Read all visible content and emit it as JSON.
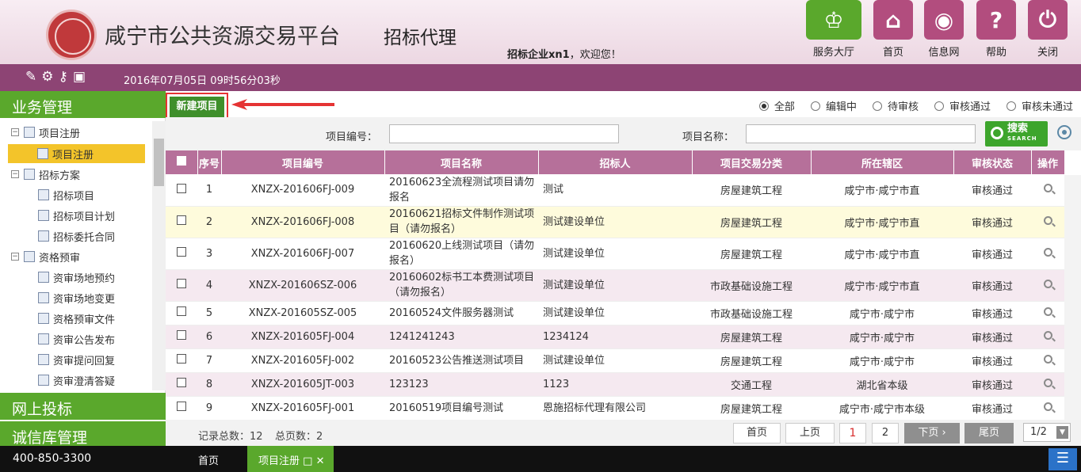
{
  "header": {
    "site_title": "咸宁市公共资源交易平台",
    "sub_title": "招标代理",
    "welcome_user": "招标企业xn1",
    "welcome_suffix": "，欢迎您！",
    "nav": [
      {
        "label": "服务大厅",
        "icon": "service-hall-icon",
        "color": "#5aa82c"
      },
      {
        "label": "首页",
        "icon": "home-icon",
        "color": "#b24d7e"
      },
      {
        "label": "信息网",
        "icon": "globe-icon",
        "color": "#b24d7e"
      },
      {
        "label": "帮助",
        "icon": "help-icon",
        "color": "#b24d7e"
      },
      {
        "label": "关闭",
        "icon": "power-icon",
        "color": "#b24d7e"
      }
    ]
  },
  "toolbar": {
    "datetime": "2016年07月05日 09时56分03秒",
    "icons": [
      "chat-icon",
      "gear-icon",
      "key-icon",
      "gift-icon"
    ]
  },
  "sidebar": {
    "sections": [
      "业务管理",
      "网上投标",
      "诚信库管理"
    ],
    "tree": [
      {
        "label": "项目注册",
        "level": 0
      },
      {
        "label": "项目注册",
        "level": 1,
        "selected": true
      },
      {
        "label": "招标方案",
        "level": 0
      },
      {
        "label": "招标项目",
        "level": 1
      },
      {
        "label": "招标项目计划",
        "level": 1
      },
      {
        "label": "招标委托合同",
        "level": 1
      },
      {
        "label": "资格预审",
        "level": 0
      },
      {
        "label": "资审场地预约",
        "level": 1
      },
      {
        "label": "资审场地变更",
        "level": 1
      },
      {
        "label": "资格预审文件",
        "level": 1
      },
      {
        "label": "资审公告发布",
        "level": 1
      },
      {
        "label": "资审提问回复",
        "level": 1
      },
      {
        "label": "资审澄清答疑",
        "level": 1
      }
    ]
  },
  "main": {
    "new_button": "新建项目",
    "filters": [
      "全部",
      "编辑中",
      "待审核",
      "审核通过",
      "审核未通过"
    ],
    "filter_selected": "全部",
    "search": {
      "code_label": "项目编号：",
      "name_label": "项目名称：",
      "button": "搜索",
      "button_sub": "SEARCH"
    },
    "columns": [
      "序号",
      "项目编号",
      "项目名称",
      "招标人",
      "项目交易分类",
      "所在辖区",
      "审核状态",
      "操作"
    ],
    "rows": [
      [
        "1",
        "XNZX-201606FJ-009",
        "20160623全流程测试项目请勿报名",
        "测试",
        "房屋建筑工程",
        "咸宁市·咸宁市直",
        "审核通过"
      ],
      [
        "2",
        "XNZX-201606FJ-008",
        "20160621招标文件制作测试项目（请勿报名）",
        "测试建设单位",
        "房屋建筑工程",
        "咸宁市·咸宁市直",
        "审核通过"
      ],
      [
        "3",
        "XNZX-201606FJ-007",
        "20160620上线测试项目（请勿报名）",
        "测试建设单位",
        "房屋建筑工程",
        "咸宁市·咸宁市直",
        "审核通过"
      ],
      [
        "4",
        "XNZX-201606SZ-006",
        "20160602标书工本费测试项目（请勿报名）",
        "测试建设单位",
        "市政基础设施工程",
        "咸宁市·咸宁市直",
        "审核通过"
      ],
      [
        "5",
        "XNZX-201605SZ-005",
        "20160524文件服务器测试",
        "测试建设单位",
        "市政基础设施工程",
        "咸宁市·咸宁市",
        "审核通过"
      ],
      [
        "6",
        "XNZX-201605FJ-004",
        "1241241243",
        "1234124",
        "房屋建筑工程",
        "咸宁市·咸宁市",
        "审核通过"
      ],
      [
        "7",
        "XNZX-201605FJ-002",
        "20160523公告推送测试项目",
        "测试建设单位",
        "房屋建筑工程",
        "咸宁市·咸宁市",
        "审核通过"
      ],
      [
        "8",
        "XNZX-201605JT-003",
        "123123",
        "1123",
        "交通工程",
        "湖北省本级",
        "审核通过"
      ],
      [
        "9",
        "XNZX-201605FJ-001",
        "20160519项目编号测试",
        "恩施招标代理有限公司",
        "房屋建筑工程",
        "咸宁市·咸宁市本级",
        "审核通过"
      ]
    ],
    "footer": {
      "total_label": "记录总数：12",
      "pages_label": "总页数：2",
      "first": "首页",
      "prev": "上页",
      "page1": "1",
      "page2": "2",
      "next": "下页",
      "last": "尾页",
      "page_select": "1/2"
    }
  },
  "bottom": {
    "phone": "400-850-3300",
    "home_tab": "首页",
    "active_tab": "项目注册"
  }
}
